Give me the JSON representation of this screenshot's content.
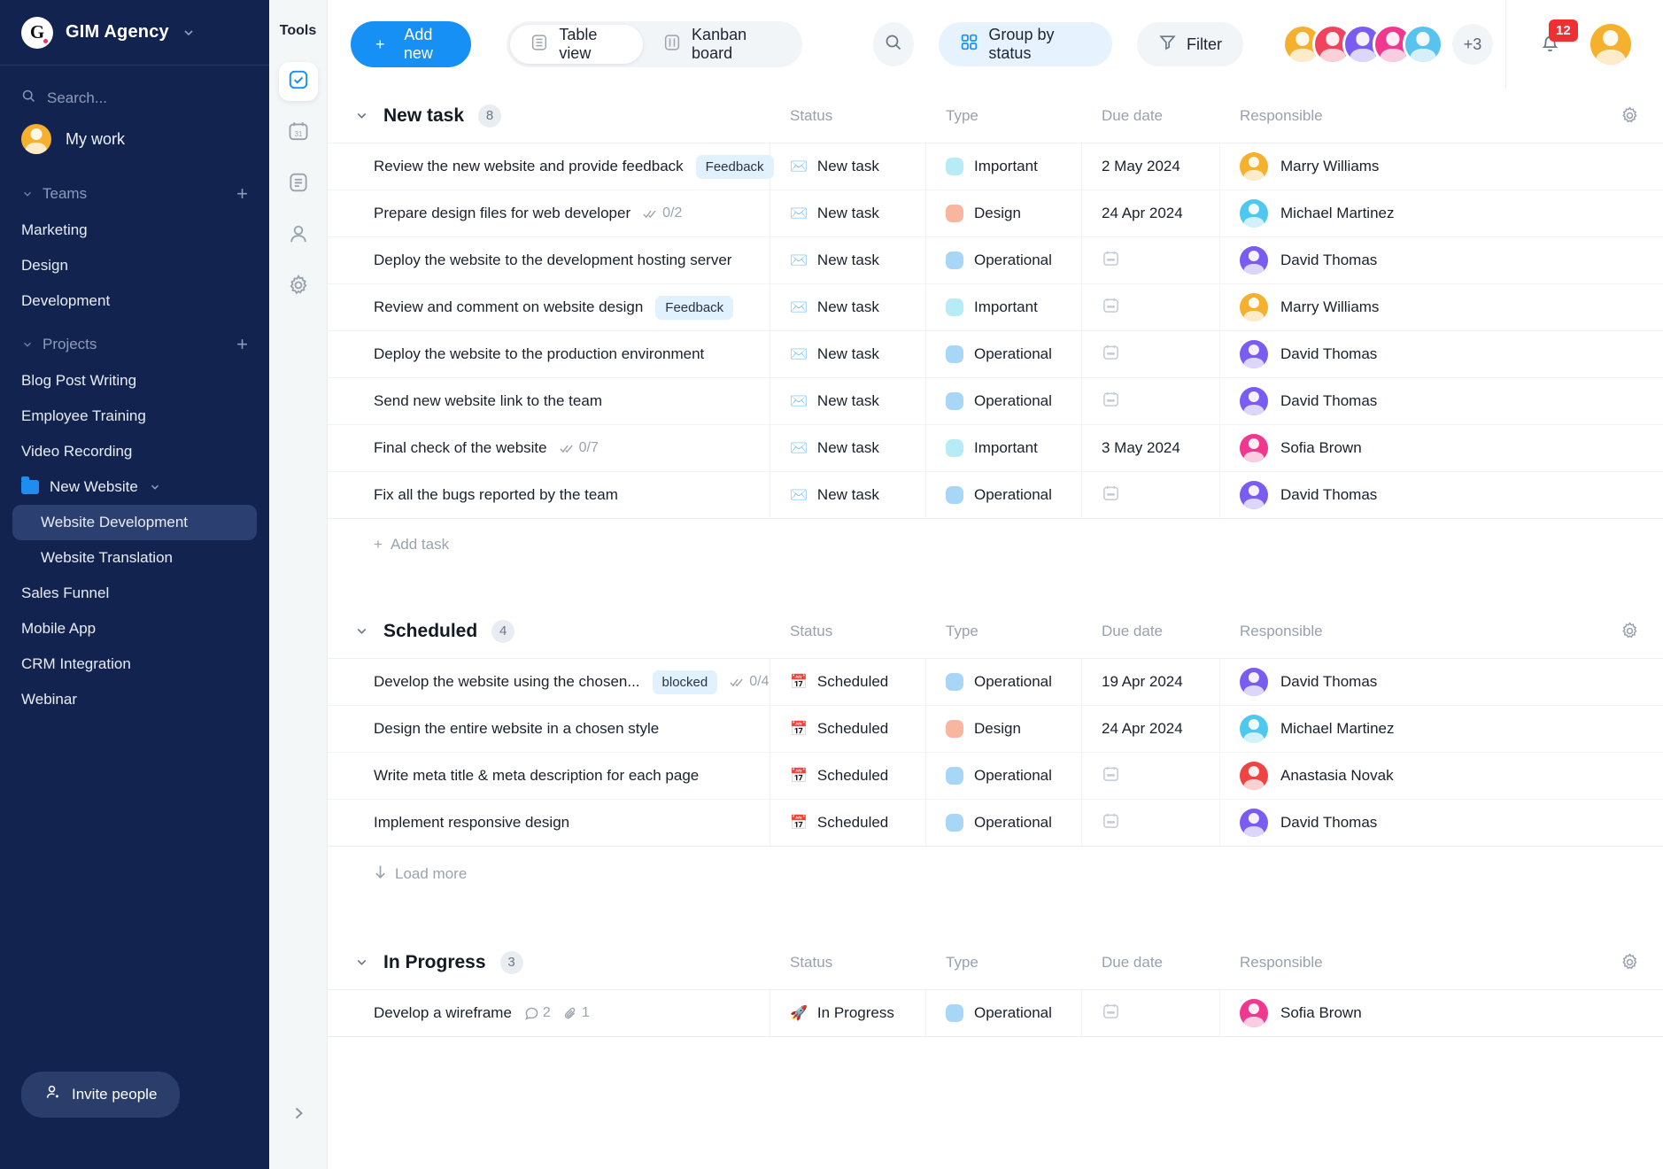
{
  "sidebar": {
    "brand": {
      "logo_letter": "G",
      "name": "GIM Agency",
      "chevron_icon": "chevron-down-icon"
    },
    "search_placeholder": "Search...",
    "my_work_label": "My work",
    "teams": {
      "label": "Teams",
      "add_icon": "plus-icon",
      "items": [
        "Marketing",
        "Design",
        "Development"
      ]
    },
    "projects": {
      "label": "Projects",
      "add_icon": "plus-icon",
      "items": [
        {
          "label": "Blog Post Writing",
          "type": "project"
        },
        {
          "label": "Employee Training",
          "type": "project"
        },
        {
          "label": "Video Recording",
          "type": "project"
        },
        {
          "label": "New Website",
          "type": "folder",
          "expanded": true
        },
        {
          "label": "Website Development",
          "type": "child",
          "active": true
        },
        {
          "label": "Website Translation",
          "type": "child",
          "active": false
        },
        {
          "label": "Sales Funnel",
          "type": "project"
        },
        {
          "label": "Mobile App",
          "type": "project"
        },
        {
          "label": "CRM Integration",
          "type": "project"
        },
        {
          "label": "Webinar",
          "type": "project"
        }
      ]
    },
    "invite_label": "Invite people",
    "invite_icon": "person-add-icon"
  },
  "rail": {
    "title": "Tools",
    "items": [
      {
        "icon": "checkbox-check-icon",
        "active": true
      },
      {
        "icon": "calendar-31-icon",
        "active": false
      },
      {
        "icon": "document-lines-icon",
        "active": false
      },
      {
        "icon": "person-icon",
        "active": false
      },
      {
        "icon": "gear-icon",
        "active": false
      }
    ],
    "expand_icon": "chevron-right-icon"
  },
  "toolbar": {
    "add_new_label": "Add new",
    "add_new_icon": "plus-icon",
    "views": [
      {
        "label": "Table view",
        "icon": "table-icon",
        "active": true
      },
      {
        "label": "Kanban board",
        "icon": "kanban-icon",
        "active": false
      }
    ],
    "search_icon": "search-icon",
    "group_by_label": "Group by status",
    "group_by_icon": "grid-squares-icon",
    "filter_label": "Filter",
    "filter_icon": "funnel-icon",
    "extra_members_label": "+3",
    "notification_count": "12",
    "bell_icon": "bell-icon",
    "accent_color": "#1790f5",
    "member_avatars": [
      "av-yellow",
      "av-rose",
      "av-purple",
      "av-pink",
      "av-blue"
    ]
  },
  "columns": {
    "task": "",
    "status": "Status",
    "type": "Type",
    "due_date": "Due date",
    "responsible": "Responsible",
    "settings_icon": "gear-icon"
  },
  "groups": [
    {
      "title": "New task",
      "count": "8",
      "caret_icon": "chevron-down-icon",
      "footer": {
        "label": "Add task",
        "icon": "plus-icon",
        "kind": "add"
      },
      "rows": [
        {
          "task": "Review the new website and provide feedback",
          "tag": "Feedback",
          "status": "New task",
          "status_icon": "envelope-icon",
          "type": "Important",
          "type_color": "#b7ecf7",
          "due": "2 May 2024",
          "responsible": "Marry Williams",
          "avatar": "av-yellow"
        },
        {
          "task": "Prepare design files for web developer",
          "subtasks": "0/2",
          "status": "New task",
          "status_icon": "envelope-icon",
          "type": "Design",
          "type_color": "#f8b5a0",
          "due": "24 Apr 2024",
          "responsible": "Michael Martinez",
          "avatar": "av-cyan"
        },
        {
          "task": "Deploy the website to the development hosting server",
          "status": "New task",
          "status_icon": "envelope-icon",
          "type": "Operational",
          "type_color": "#a8d6f7",
          "due": "",
          "responsible": "David Thomas",
          "avatar": "av-purple"
        },
        {
          "task": "Review and comment on website design",
          "tag": "Feedback",
          "status": "New task",
          "status_icon": "envelope-icon",
          "type": "Important",
          "type_color": "#b7ecf7",
          "due": "",
          "responsible": "Marry Williams",
          "avatar": "av-yellow"
        },
        {
          "task": "Deploy the website to the production environment",
          "status": "New task",
          "status_icon": "envelope-icon",
          "type": "Operational",
          "type_color": "#a8d6f7",
          "due": "",
          "responsible": "David Thomas",
          "avatar": "av-purple"
        },
        {
          "task": "Send new website link to the team",
          "status": "New task",
          "status_icon": "envelope-icon",
          "type": "Operational",
          "type_color": "#a8d6f7",
          "due": "",
          "responsible": "David Thomas",
          "avatar": "av-purple"
        },
        {
          "task": "Final check of the website",
          "subtasks": "0/7",
          "status": "New task",
          "status_icon": "envelope-icon",
          "type": "Important",
          "type_color": "#b7ecf7",
          "due": "3 May 2024",
          "responsible": "Sofia Brown",
          "avatar": "av-pink"
        },
        {
          "task": "Fix all the bugs reported by the team",
          "status": "New task",
          "status_icon": "envelope-icon",
          "type": "Operational",
          "type_color": "#a8d6f7",
          "due": "",
          "responsible": "David Thomas",
          "avatar": "av-purple"
        }
      ]
    },
    {
      "title": "Scheduled",
      "count": "4",
      "caret_icon": "chevron-down-icon",
      "footer": {
        "label": "Load more",
        "icon": "arrow-down-icon",
        "kind": "load"
      },
      "rows": [
        {
          "task": "Develop the website using the chosen...",
          "tag": "blocked",
          "subtasks": "0/4",
          "status": "Scheduled",
          "status_icon": "calendar-17-icon",
          "type": "Operational",
          "type_color": "#a8d6f7",
          "due": "19 Apr 2024",
          "responsible": "David Thomas",
          "avatar": "av-purple"
        },
        {
          "task": "Design the entire website in a chosen style",
          "status": "Scheduled",
          "status_icon": "calendar-17-icon",
          "type": "Design",
          "type_color": "#f8b5a0",
          "due": "24 Apr 2024",
          "responsible": "Michael Martinez",
          "avatar": "av-cyan"
        },
        {
          "task": "Write meta title & meta description for each page",
          "status": "Scheduled",
          "status_icon": "calendar-17-icon",
          "type": "Operational",
          "type_color": "#a8d6f7",
          "due": "",
          "responsible": "Anastasia Novak",
          "avatar": "av-red"
        },
        {
          "task": "Implement responsive design",
          "status": "Scheduled",
          "status_icon": "calendar-17-icon",
          "type": "Operational",
          "type_color": "#a8d6f7",
          "due": "",
          "responsible": "David Thomas",
          "avatar": "av-purple"
        }
      ]
    },
    {
      "title": "In Progress",
      "count": "3",
      "caret_icon": "chevron-down-icon",
      "footer": null,
      "rows": [
        {
          "task": "Develop a wireframe",
          "comments": "2",
          "attachments": "1",
          "status": "In Progress",
          "status_icon": "rocket-icon",
          "type": "Operational",
          "type_color": "#a8d6f7",
          "due": "",
          "responsible": "Sofia Brown",
          "avatar": "av-pink"
        }
      ]
    }
  ]
}
